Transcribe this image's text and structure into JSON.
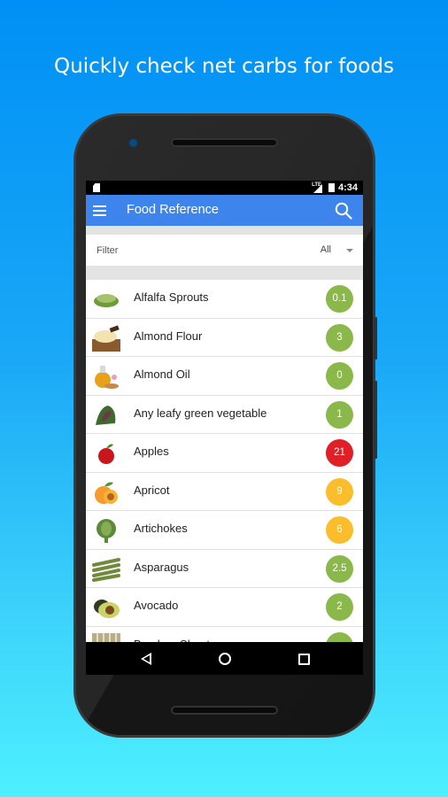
{
  "headline": "Quickly check net carbs for foods",
  "status_bar": {
    "network": "LTE",
    "time": "4:34"
  },
  "app_bar": {
    "title": "Food Reference",
    "menu_icon": "hamburger-menu-icon",
    "search_icon": "search-icon"
  },
  "filter": {
    "label": "Filter",
    "selected": "All"
  },
  "colors": {
    "app_bar": "#3d84ec",
    "low": "#8bb84a",
    "medium": "#fbbd2b",
    "high": "#e01f26"
  },
  "foods": [
    {
      "name": "Alfalfa Sprouts",
      "net_carbs": "0.1",
      "level": "low",
      "thumb": "sprouts"
    },
    {
      "name": "Almond Flour",
      "net_carbs": "3",
      "level": "low",
      "thumb": "flour"
    },
    {
      "name": "Almond Oil",
      "net_carbs": "0",
      "level": "low",
      "thumb": "oil"
    },
    {
      "name": "Any leafy green vegetable",
      "net_carbs": "1",
      "level": "low",
      "thumb": "greens"
    },
    {
      "name": "Apples",
      "net_carbs": "21",
      "level": "high",
      "thumb": "apple"
    },
    {
      "name": "Apricot",
      "net_carbs": "9",
      "level": "medium",
      "thumb": "apricot"
    },
    {
      "name": "Artichokes",
      "net_carbs": "6",
      "level": "medium",
      "thumb": "artichoke"
    },
    {
      "name": "Asparagus",
      "net_carbs": "2.5",
      "level": "low",
      "thumb": "asparagus"
    },
    {
      "name": "Avocado",
      "net_carbs": "2",
      "level": "low",
      "thumb": "avocado"
    },
    {
      "name": "Bamboo Shoots",
      "net_carbs": "",
      "level": "low",
      "thumb": "bamboo"
    }
  ]
}
